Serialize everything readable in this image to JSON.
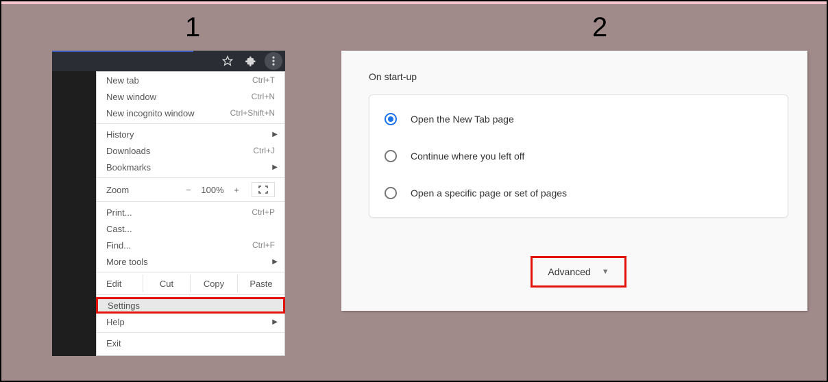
{
  "steps": {
    "one": "1",
    "two": "2"
  },
  "menu": {
    "new_tab": {
      "label": "New tab",
      "shortcut": "Ctrl+T"
    },
    "new_window": {
      "label": "New window",
      "shortcut": "Ctrl+N"
    },
    "new_incognito": {
      "label": "New incognito window",
      "shortcut": "Ctrl+Shift+N"
    },
    "history": {
      "label": "History"
    },
    "downloads": {
      "label": "Downloads",
      "shortcut": "Ctrl+J"
    },
    "bookmarks": {
      "label": "Bookmarks"
    },
    "zoom": {
      "label": "Zoom",
      "minus": "−",
      "value": "100%",
      "plus": "+"
    },
    "print": {
      "label": "Print...",
      "shortcut": "Ctrl+P"
    },
    "cast": {
      "label": "Cast..."
    },
    "find": {
      "label": "Find...",
      "shortcut": "Ctrl+F"
    },
    "more_tools": {
      "label": "More tools"
    },
    "edit": {
      "label": "Edit",
      "cut": "Cut",
      "copy": "Copy",
      "paste": "Paste"
    },
    "settings": {
      "label": "Settings"
    },
    "help": {
      "label": "Help"
    },
    "exit": {
      "label": "Exit"
    }
  },
  "settings": {
    "section_title": "On start-up",
    "options": {
      "new_tab": "Open the New Tab page",
      "continue": "Continue where you left off",
      "specific": "Open a specific page or set of pages"
    },
    "selected": "new_tab",
    "advanced_label": "Advanced"
  }
}
